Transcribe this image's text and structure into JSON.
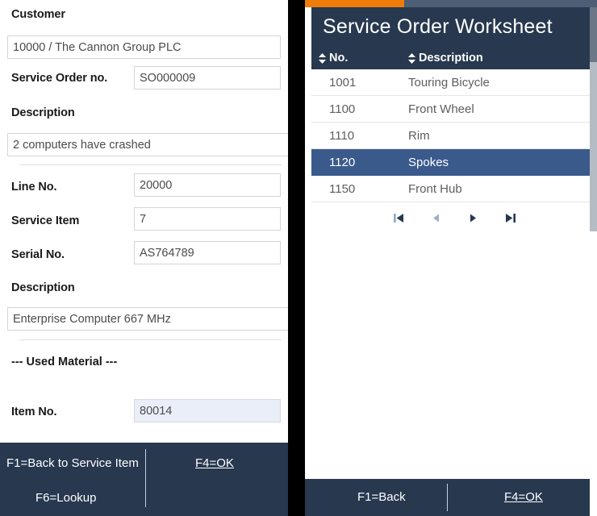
{
  "left_panel": {
    "customer": {
      "label": "Customer",
      "value": "10000 / The Cannon Group PLC"
    },
    "service_order_no": {
      "label": "Service Order no.",
      "value": "SO000009"
    },
    "description_top": {
      "label": "Description",
      "value": "2 computers have crashed"
    },
    "line_no": {
      "label": "Line No.",
      "value": "20000"
    },
    "service_item": {
      "label": "Service Item",
      "value": "7"
    },
    "serial_no": {
      "label": "Serial No.",
      "value": "AS764789"
    },
    "description_item": {
      "label": "Description",
      "value": "Enterprise Computer 667 MHz"
    },
    "used_material_header": "--- Used Material ---",
    "item_no": {
      "label": "Item No.",
      "value": "80014"
    },
    "footer": {
      "f1_label": "F1=Back to Service Item",
      "f6_label": "F6=Lookup",
      "f4_label": "F4=OK"
    }
  },
  "right_panel": {
    "progress_percent": 34,
    "title": "Service Order Worksheet",
    "grid": {
      "columns": [
        {
          "key": "no",
          "label": "No."
        },
        {
          "key": "description",
          "label": "Description"
        }
      ],
      "rows": [
        {
          "no": "1001",
          "description": "Touring Bicycle",
          "selected": false
        },
        {
          "no": "1100",
          "description": "Front Wheel",
          "selected": false
        },
        {
          "no": "1110",
          "description": "Rim",
          "selected": false
        },
        {
          "no": "1120",
          "description": "Spokes",
          "selected": true
        },
        {
          "no": "1150",
          "description": "Front Hub",
          "selected": false
        }
      ]
    },
    "pager": {
      "first_label": "First page",
      "prev_label": "Previous page",
      "next_label": "Next page",
      "last_label": "Last page"
    },
    "footer": {
      "f1_label": "F1=Back",
      "f4_label": "F4=OK"
    }
  },
  "colors": {
    "navy": "#27384f",
    "orange": "#ef7d0b",
    "row_selected": "#3a5a8c",
    "focus_field": "#e9eef8"
  }
}
